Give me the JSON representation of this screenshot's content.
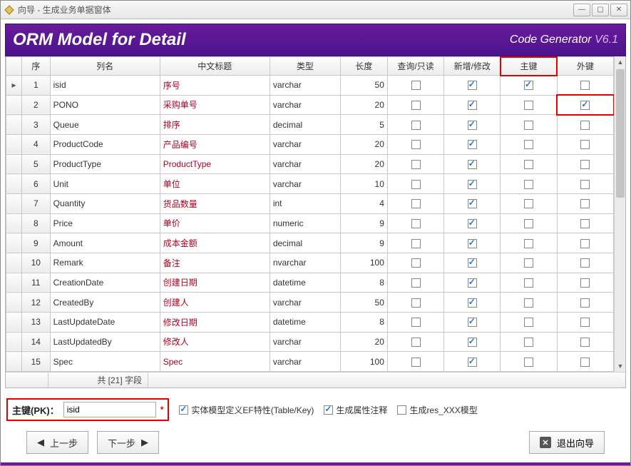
{
  "window": {
    "title": "向导 - 生成业务单据窗体"
  },
  "header": {
    "title": "ORM Model for Detail",
    "brand": "Code Generator",
    "version": "V6.1"
  },
  "grid": {
    "headers": {
      "seq": "序",
      "colname": "列名",
      "cn_title": "中文标题",
      "type": "类型",
      "length": "长度",
      "query_ro": "查询/只读",
      "add_edit": "新增/修改",
      "pk": "主键",
      "fk": "外键"
    },
    "rows": [
      {
        "n": 1,
        "col": "isid",
        "cn": "序号",
        "type": "varchar",
        "len": 50,
        "qro": false,
        "ae": true,
        "pk": true,
        "fk": false,
        "indicator": "▸"
      },
      {
        "n": 2,
        "col": "PONO",
        "cn": "采购单号",
        "type": "varchar",
        "len": 20,
        "qro": false,
        "ae": true,
        "pk": false,
        "fk": true,
        "indicator": ""
      },
      {
        "n": 3,
        "col": "Queue",
        "cn": "排序",
        "type": "decimal",
        "len": 5,
        "qro": false,
        "ae": true,
        "pk": false,
        "fk": false,
        "indicator": ""
      },
      {
        "n": 4,
        "col": "ProductCode",
        "cn": "产品编号",
        "type": "varchar",
        "len": 20,
        "qro": false,
        "ae": true,
        "pk": false,
        "fk": false,
        "indicator": ""
      },
      {
        "n": 5,
        "col": "ProductType",
        "cn": "ProductType",
        "type": "varchar",
        "len": 20,
        "qro": false,
        "ae": true,
        "pk": false,
        "fk": false,
        "indicator": ""
      },
      {
        "n": 6,
        "col": "Unit",
        "cn": "单位",
        "type": "varchar",
        "len": 10,
        "qro": false,
        "ae": true,
        "pk": false,
        "fk": false,
        "indicator": ""
      },
      {
        "n": 7,
        "col": "Quantity",
        "cn": "货品数量",
        "type": "int",
        "len": 4,
        "qro": false,
        "ae": true,
        "pk": false,
        "fk": false,
        "indicator": ""
      },
      {
        "n": 8,
        "col": "Price",
        "cn": "单价",
        "type": "numeric",
        "len": 9,
        "qro": false,
        "ae": true,
        "pk": false,
        "fk": false,
        "indicator": ""
      },
      {
        "n": 9,
        "col": "Amount",
        "cn": "成本金额",
        "type": "decimal",
        "len": 9,
        "qro": false,
        "ae": true,
        "pk": false,
        "fk": false,
        "indicator": ""
      },
      {
        "n": 10,
        "col": "Remark",
        "cn": "备注",
        "type": "nvarchar",
        "len": 100,
        "qro": false,
        "ae": true,
        "pk": false,
        "fk": false,
        "indicator": ""
      },
      {
        "n": 11,
        "col": "CreationDate",
        "cn": "创建日期",
        "type": "datetime",
        "len": 8,
        "qro": false,
        "ae": true,
        "pk": false,
        "fk": false,
        "indicator": ""
      },
      {
        "n": 12,
        "col": "CreatedBy",
        "cn": "创建人",
        "type": "varchar",
        "len": 50,
        "qro": false,
        "ae": true,
        "pk": false,
        "fk": false,
        "indicator": ""
      },
      {
        "n": 13,
        "col": "LastUpdateDate",
        "cn": "修改日期",
        "type": "datetime",
        "len": 8,
        "qro": false,
        "ae": true,
        "pk": false,
        "fk": false,
        "indicator": ""
      },
      {
        "n": 14,
        "col": "LastUpdatedBy",
        "cn": "修改人",
        "type": "varchar",
        "len": 20,
        "qro": false,
        "ae": true,
        "pk": false,
        "fk": false,
        "indicator": ""
      },
      {
        "n": 15,
        "col": "Spec",
        "cn": "Spec",
        "type": "varchar",
        "len": 100,
        "qro": false,
        "ae": true,
        "pk": false,
        "fk": false,
        "indicator": ""
      }
    ],
    "footer_summary": "共 [21] 字段"
  },
  "pk_section": {
    "label": "主键(PK)：",
    "value": "isid",
    "required_mark": "*"
  },
  "options": {
    "ef_attr": {
      "label": "实体模型定义EF特性(Table/Key)",
      "checked": true
    },
    "gen_annotation": {
      "label": "生成属性注释",
      "checked": true
    },
    "gen_res": {
      "label": "生成res_XXX模型",
      "checked": false
    }
  },
  "nav": {
    "prev": "上一步",
    "next": "下一步",
    "exit": "退出向导"
  },
  "highlights": {
    "pk_header_col": true,
    "fk_cell_row": 2
  }
}
